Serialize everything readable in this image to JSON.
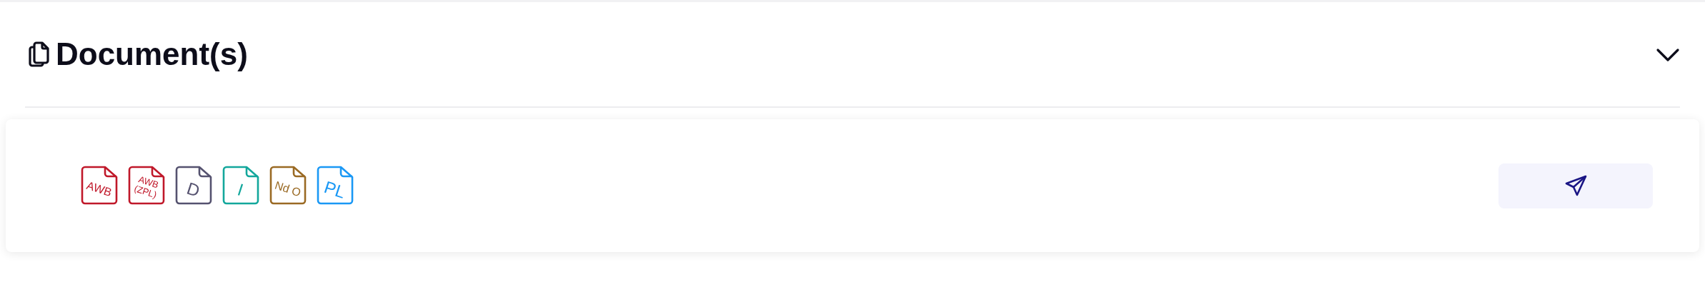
{
  "section": {
    "title": "Document(s)",
    "expanded": true
  },
  "documents": [
    {
      "lines": [
        "AWB"
      ],
      "color": "#c0182a"
    },
    {
      "lines": [
        "AWB",
        "(ZPL)"
      ],
      "color": "#c0182a"
    },
    {
      "lines": [
        "D"
      ],
      "color": "#55526f"
    },
    {
      "lines": [
        "I"
      ],
      "color": "#13a79c"
    },
    {
      "lines": [
        "Nd O"
      ],
      "color": "#9a6a24"
    },
    {
      "lines": [
        "PL"
      ],
      "color": "#1a98f5"
    }
  ]
}
